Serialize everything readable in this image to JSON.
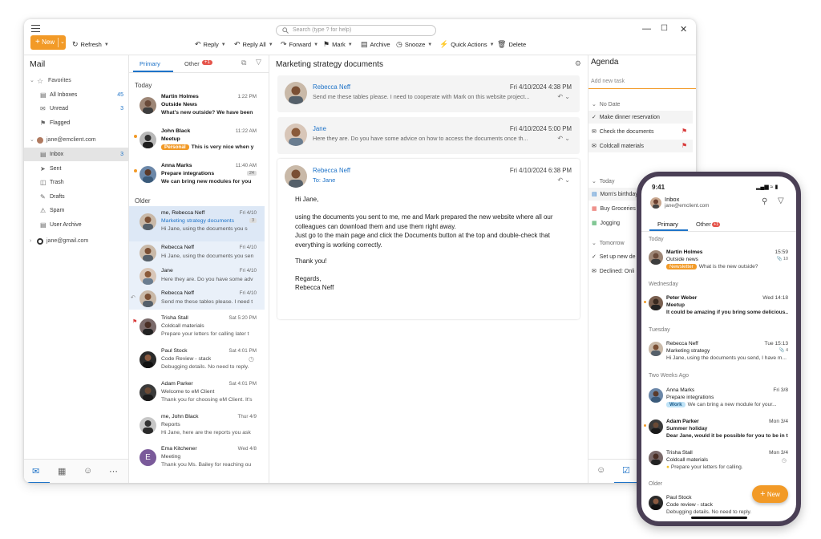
{
  "desktop": {
    "search_placeholder": "Search (type ? for help)",
    "new_label": "New",
    "refresh_label": "Refresh",
    "toolbar": {
      "reply": "Reply",
      "reply_all": "Reply All",
      "forward": "Forward",
      "mark": "Mark",
      "archive": "Archive",
      "snooze": "Snooze",
      "quick_actions": "Quick Actions",
      "delete": "Delete"
    },
    "sidebar": {
      "title": "Mail",
      "favorites": "Favorites",
      "fav_items": [
        {
          "label": "All Inboxes",
          "count": "45"
        },
        {
          "label": "Unread",
          "count": "3"
        },
        {
          "label": "Flagged",
          "count": ""
        }
      ],
      "account1": "jane@emclient.com",
      "folders": [
        {
          "label": "Inbox",
          "count": "3"
        },
        {
          "label": "Sent",
          "count": ""
        },
        {
          "label": "Trash",
          "count": ""
        },
        {
          "label": "Drafts",
          "count": ""
        },
        {
          "label": "Spam",
          "count": ""
        },
        {
          "label": "User Archive",
          "count": ""
        }
      ],
      "account2": "jane@gmail.com"
    },
    "list": {
      "tab_primary": "Primary",
      "tab_other": "Other",
      "other_badge": "+1",
      "section_today": "Today",
      "section_older": "Older",
      "items": [
        {
          "sender": "Martin Holmes",
          "time": "1:22 PM",
          "subject": "Outside News",
          "preview": "What's new outside? We have been",
          "tag": ""
        },
        {
          "sender": "John Black",
          "time": "11:22 AM",
          "subject": "Meetup",
          "preview": "This is very nice when y",
          "tag": "Personal"
        },
        {
          "sender": "Anna Marks",
          "time": "11:40 AM",
          "subject": "Prepare integrations",
          "preview": "We can bring new modules for you",
          "badge": "24"
        },
        {
          "sender": "me, Rebecca Neff",
          "time": "Fri 4/10",
          "subject": "Marketing strategy documents",
          "preview": "Hi Jane, using the documents you s",
          "badge": "3"
        },
        {
          "sender": "Rebecca Neff",
          "time": "Fri 4/10",
          "subject": "",
          "preview": "Hi Jane, using the documents you sen"
        },
        {
          "sender": "Jane",
          "time": "Fri 4/10",
          "subject": "",
          "preview": "Here they are. Do you have some adv"
        },
        {
          "sender": "Rebecca Neff",
          "time": "Fri 4/10",
          "subject": "",
          "preview": "Send me these tables please. I need t"
        },
        {
          "sender": "Trisha Stall",
          "time": "Sat 5:20 PM",
          "subject": "Coldcall materials",
          "preview": "Prepare your letters for calling later t"
        },
        {
          "sender": "Paul Stock",
          "time": "Sat 4:01 PM",
          "subject": "Code Review - stack",
          "preview": "Debugging details. No need to reply."
        },
        {
          "sender": "Adam Parker",
          "time": "Sat 4:01 PM",
          "subject": "Welcome to eM Client",
          "preview": "Thank you for choosing eM Client. It's"
        },
        {
          "sender": "me, John Black",
          "time": "Thur 4/9",
          "subject": "Reports",
          "preview": "Hi Jane, here are the reports you ask"
        },
        {
          "sender": "Ema Kitchener",
          "time": "Wed 4/8",
          "subject": "Meeting",
          "preview": "Thank you Ms. Bailey for reaching ou",
          "initial": "E"
        }
      ]
    },
    "reader": {
      "title": "Marketing strategy documents",
      "messages": [
        {
          "from": "Rebecca Neff",
          "date": "Fri 4/10/2024 4:38 PM",
          "preview": "Send me these tables please. I need to cooperate with Mark on this website project..."
        },
        {
          "from": "Jane",
          "date": "Fri 4/10/2024 5:00 PM",
          "preview": "Here they are. Do you have some advice on how to access the documents once th..."
        },
        {
          "from": "Rebecca Neff",
          "date": "Fri 4/10/2024 6:38 PM",
          "to": "To: Jane"
        }
      ],
      "body": [
        "Hi Jane,",
        "using the documents you sent to me, me and Mark prepared the new website where all our colleagues can download them and use them right away.",
        "Just go to the main page and click the Documents button at the top and double-check that everything is working correctly.",
        "Thank you!",
        "Regards,",
        "Rebecca Neff"
      ]
    },
    "agenda": {
      "title": "Agenda",
      "add_placeholder": "Add new task",
      "no_date": "No Date",
      "items_nodate": [
        "Make dinner reservation",
        "Check the documents",
        "Coldcall materials"
      ],
      "today": "Today",
      "items_today": [
        "Mom's birthday",
        "Buy Groceries",
        "Jogging"
      ],
      "tomorrow": "Tomorrow",
      "items_tomorrow": [
        "Set up new de",
        "Declined: Onli"
      ]
    }
  },
  "phone": {
    "time": "9:41",
    "inbox": "Inbox",
    "account": "jane@emclient.com",
    "tab_primary": "Primary",
    "tab_other": "Other",
    "other_badge": "+1",
    "sections": [
      "Today",
      "Wednesday",
      "Tuesday",
      "Two Weeks Ago",
      "Older"
    ],
    "items": [
      {
        "sender": "Martin Holmes",
        "time": "15:59",
        "subject": "Outside news",
        "preview": "What is the new outside?",
        "tag": "Newsletter",
        "badge": "10"
      },
      {
        "sender": "Peter Weber",
        "time": "Wed 14:18",
        "subject": "Meetup",
        "preview": "It could be amazing if you bring some delicious..."
      },
      {
        "sender": "Rebecca Neff",
        "time": "Tue 15:13",
        "subject": "Marketing strategy",
        "preview": "Hi Jane, using the documents you send, I have m...",
        "badge": "4"
      },
      {
        "sender": "Anna Marks",
        "time": "Fri 3/8",
        "subject": "Prepare integrations",
        "preview": "We can bring a new module for your...",
        "tag": "Work"
      },
      {
        "sender": "Adam Parker",
        "time": "Mon 3/4",
        "subject": "Summer holiday",
        "preview": "Dear Jane, would it be possible for you to be in th..."
      },
      {
        "sender": "Trisha Stall",
        "time": "Mon 3/4",
        "subject": "Coldcall materials",
        "preview": "Prepare your letters for calling."
      },
      {
        "sender": "Paul Stock",
        "time": "",
        "subject": "Code review - stack",
        "preview": "Debugging details. No need to reply."
      }
    ],
    "new_label": "New"
  },
  "colors": {
    "accent": "#f29a27",
    "link": "#1e73c8",
    "selected": "#dde8f6",
    "phone_frame": "#4a3f55"
  }
}
